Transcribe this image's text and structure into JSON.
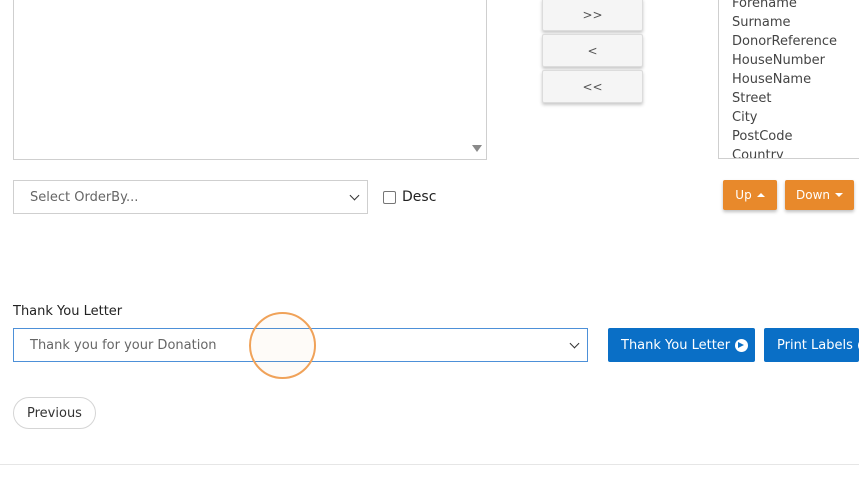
{
  "move_buttons": {
    "add_all": ">>",
    "remove": "<",
    "remove_all": "<<"
  },
  "available_fields": [
    "Forename",
    "Surname",
    "DonorReference",
    "HouseNumber",
    "HouseName",
    "Street",
    "City",
    "PostCode",
    "Country"
  ],
  "order_by": {
    "selected": "Select OrderBy...",
    "desc_label": "Desc",
    "desc_checked": false
  },
  "sort_buttons": {
    "up_label": "Up",
    "down_label": "Down"
  },
  "thank_you_letter": {
    "heading": "Thank You Letter",
    "selected": "Thank you for your Donation",
    "letter_button_label": "Thank You Letter",
    "labels_button_label": "Print Labels"
  },
  "navigation": {
    "previous_label": "Previous"
  },
  "colors": {
    "orange": "#e8892b",
    "blue": "#0a6fc6",
    "click_indicator": "#f0a259"
  }
}
